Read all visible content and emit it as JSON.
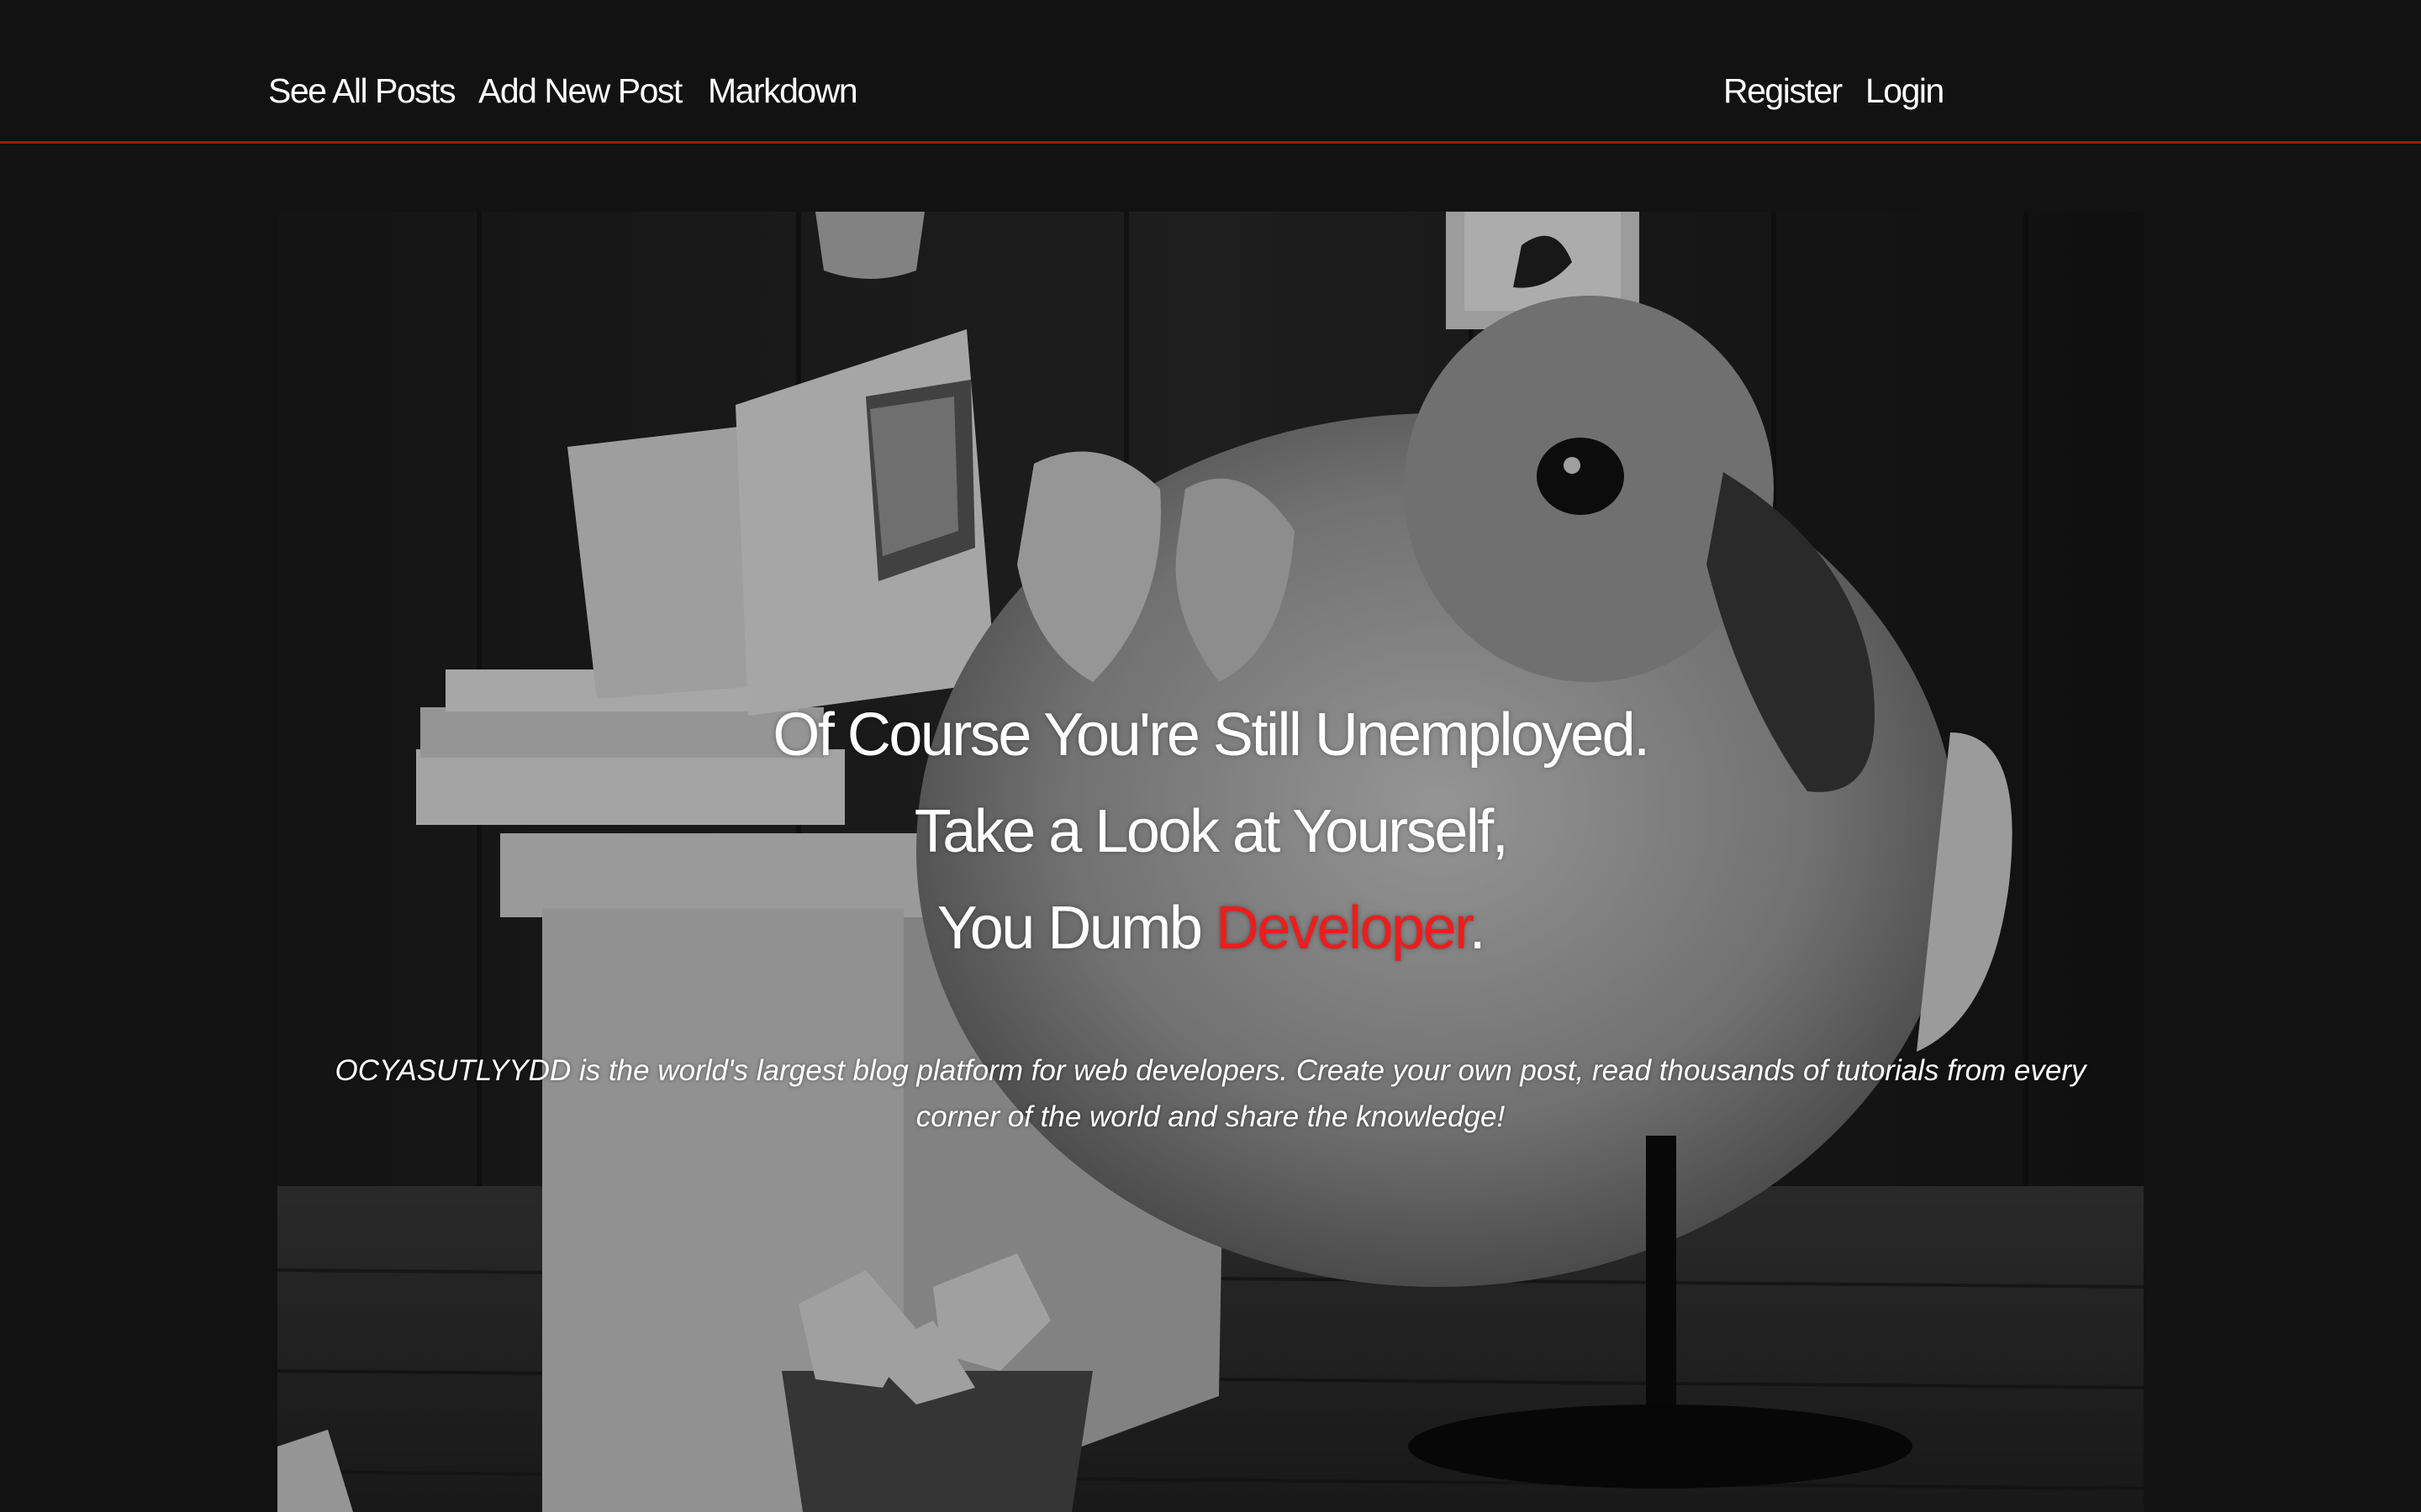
{
  "nav": {
    "left_links": [
      {
        "label": "See All Posts"
      },
      {
        "label": "Add New Post"
      },
      {
        "label": "Markdown"
      }
    ],
    "right_links": [
      {
        "label": "Register"
      },
      {
        "label": "Login"
      }
    ]
  },
  "hero": {
    "headline_line1": "Of Course You're Still Unemployed.",
    "headline_line2": "Take a Look at Yourself,",
    "headline_line3_prefix": "You Dumb ",
    "headline_line3_accent": "Developer",
    "headline_line3_suffix": ".",
    "description": "OCYASUTLYYDD is the world's largest blog platform for web developers. Create your own post, read thousands of tutorials from every corner of the world and share the knowledge!"
  },
  "colors": {
    "background": "#121212",
    "nav_border": "#a8140f",
    "accent": "#ee1c1c",
    "text": "#ffffff"
  }
}
